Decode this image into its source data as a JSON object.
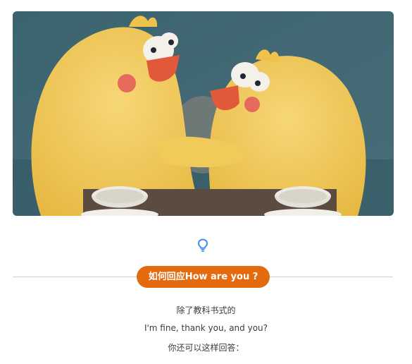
{
  "hero": {
    "alt": "Two fluffy yellow chicks hugging at a café table with teacups"
  },
  "icons": {
    "hint": "lightbulb-icon"
  },
  "section": {
    "title": "如何回应How are you ?",
    "lines": [
      "除了教科书式的",
      "I'm fine, thank you, and you?",
      "你还可以这样回答："
    ]
  },
  "colors": {
    "accent": "#e36a0f",
    "icon_blue": "#3b8ef5",
    "text": "#3b3b3b",
    "divider": "#cfcfcf"
  }
}
